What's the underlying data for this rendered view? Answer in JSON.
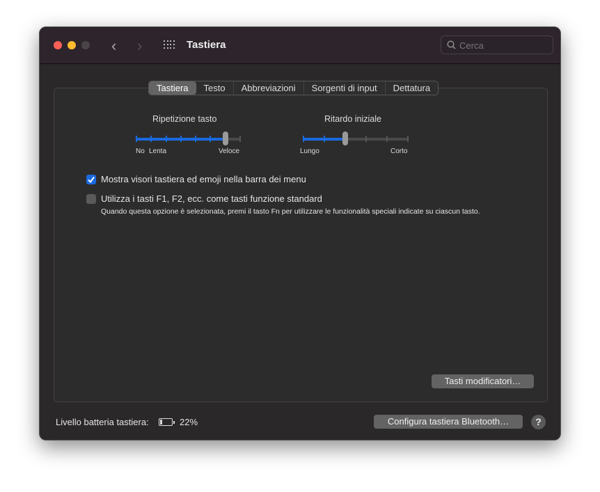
{
  "window": {
    "title": "Tastiera",
    "search_placeholder": "Cerca"
  },
  "tabs": [
    {
      "label": "Tastiera",
      "selected": true
    },
    {
      "label": "Testo"
    },
    {
      "label": "Abbreviazioni"
    },
    {
      "label": "Sorgenti di input"
    },
    {
      "label": "Dettatura"
    }
  ],
  "key_repeat": {
    "label": "Ripetizione tasto",
    "min_label": "No",
    "low_label": "Lenta",
    "max_label": "Veloce",
    "steps": 8,
    "value": 6
  },
  "delay_until_repeat": {
    "label": "Ritardo iniziale",
    "min_label": "Lungo",
    "max_label": "Corto",
    "steps": 6,
    "value": 2
  },
  "options": [
    {
      "label": "Mostra visori tastiera ed emoji nella barra dei menu",
      "checked": true
    },
    {
      "label": "Utilizza i tasti F1, F2, ecc. come tasti funzione standard",
      "checked": false,
      "description": "Quando questa opzione è selezionata, premi il tasto Fn per utilizzare le funzionalità speciali indicate su ciascun tasto."
    }
  ],
  "modifier_button": "Tasti modificatori…",
  "battery": {
    "label": "Livello batteria tastiera:",
    "value": "22%",
    "percent": 22
  },
  "bluetooth_button": "Configura tastiera Bluetooth…",
  "help": "?",
  "colors": {
    "accent": "#1a6ae0",
    "close": "#fe5f57",
    "minimize": "#febc2e"
  }
}
